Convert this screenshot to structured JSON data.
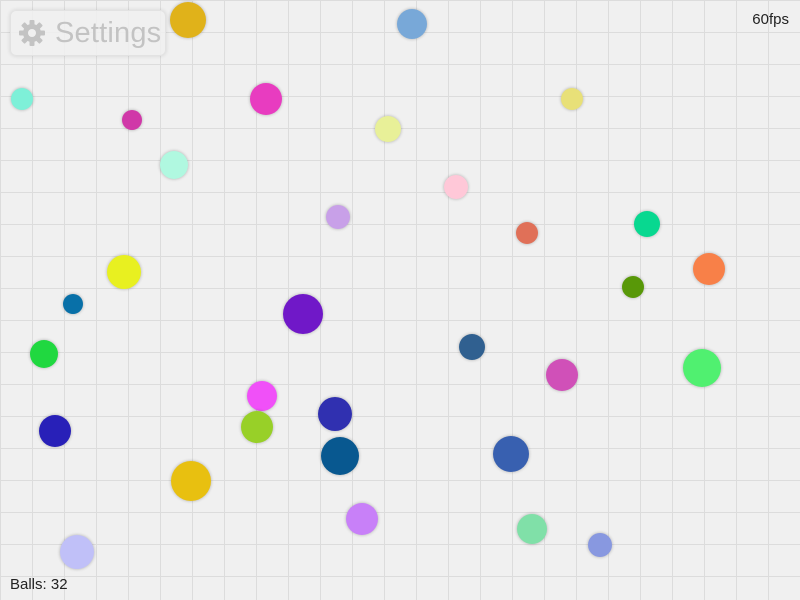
{
  "settings": {
    "label": "Settings",
    "icon": "gear-icon"
  },
  "fps_text": "60fps",
  "balls_text": "Balls: 32",
  "grid_color": "#dcdcdc",
  "background_color": "#f0f0f0",
  "balls": [
    {
      "color": "#e0b21a"
    },
    {
      "color": "#78a8d8"
    },
    {
      "color": "#7ef0d8"
    },
    {
      "color": "#d038a8"
    },
    {
      "color": "#e83cc0"
    },
    {
      "color": "#e8f098"
    },
    {
      "color": "#e8e078"
    },
    {
      "color": "#b0f8e0"
    },
    {
      "color": "#ffc8d8"
    },
    {
      "color": "#c8a0e8"
    },
    {
      "color": "#e07058"
    },
    {
      "color": "#08d890"
    },
    {
      "color": "#e8f020"
    },
    {
      "color": "#f88048"
    },
    {
      "color": "#589808"
    },
    {
      "color": "#0870a8"
    },
    {
      "color": "#7018c8"
    },
    {
      "color": "#306090"
    },
    {
      "color": "#20d840"
    },
    {
      "color": "#d050b8"
    },
    {
      "color": "#50f070"
    },
    {
      "color": "#f050f8"
    },
    {
      "color": "#3030b0"
    },
    {
      "color": "#2820b8"
    },
    {
      "color": "#98d028"
    },
    {
      "color": "#085890"
    },
    {
      "color": "#3860b0"
    },
    {
      "color": "#e8c010"
    },
    {
      "color": "#c880f8"
    },
    {
      "color": "#80e0a8"
    },
    {
      "color": "#8898e0"
    },
    {
      "color": "#c0c0f8"
    }
  ]
}
